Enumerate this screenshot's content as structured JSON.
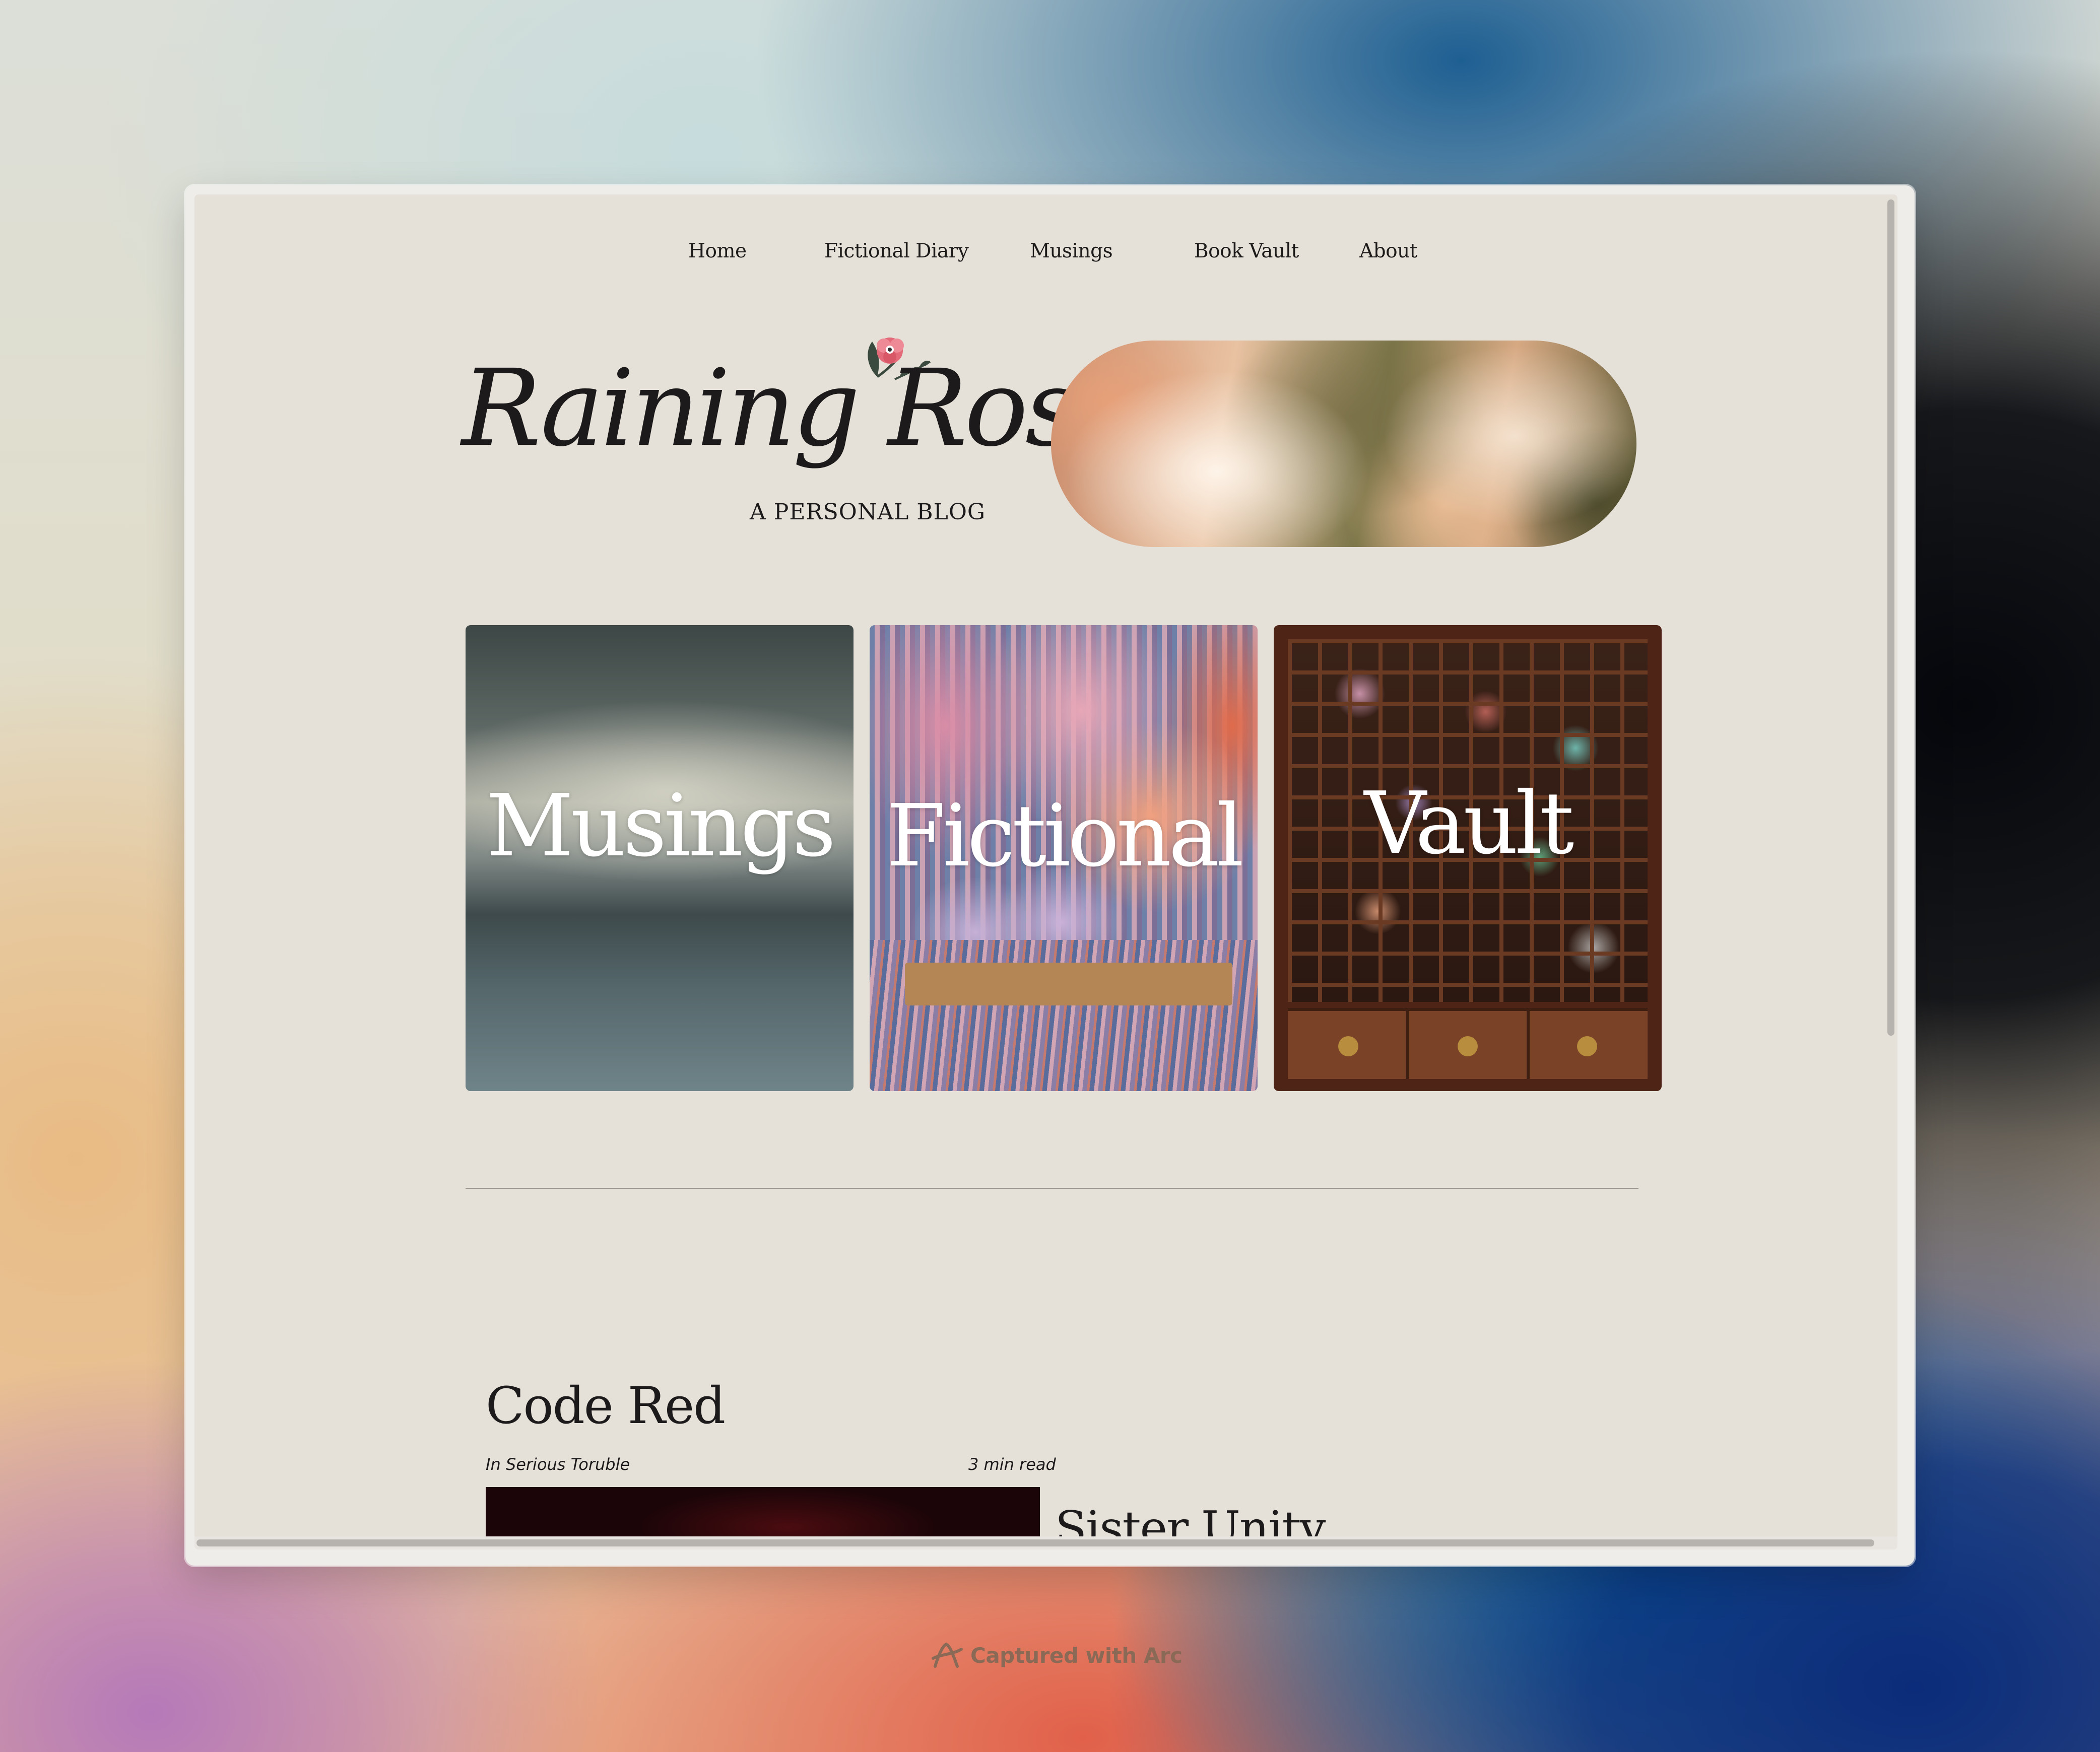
{
  "nav": {
    "items": [
      {
        "label": "Home"
      },
      {
        "label": "Fictional Diary"
      },
      {
        "label": "Musings"
      },
      {
        "label": "Book Vault"
      },
      {
        "label": "About"
      }
    ]
  },
  "header": {
    "title": "Raining Roses",
    "subtitle": "A PERSONAL BLOG"
  },
  "categories": [
    {
      "label": "Musings"
    },
    {
      "label": "Fictional"
    },
    {
      "label": "Vault"
    }
  ],
  "posts": [
    {
      "title": "Code Red",
      "category": "In Serious Toruble",
      "read_time": "3 min read"
    },
    {
      "title": "Sister Unity"
    }
  ],
  "footer": {
    "capture_label": "Captured with Arc"
  },
  "icons": {
    "flower": "rose-flower-icon",
    "arc": "arc-logo-icon"
  },
  "colors": {
    "page_background": "#e5e0d8",
    "text": "#1c1a1a",
    "rose_accent": "#e26a79",
    "leaf": "#3b4a3e"
  }
}
